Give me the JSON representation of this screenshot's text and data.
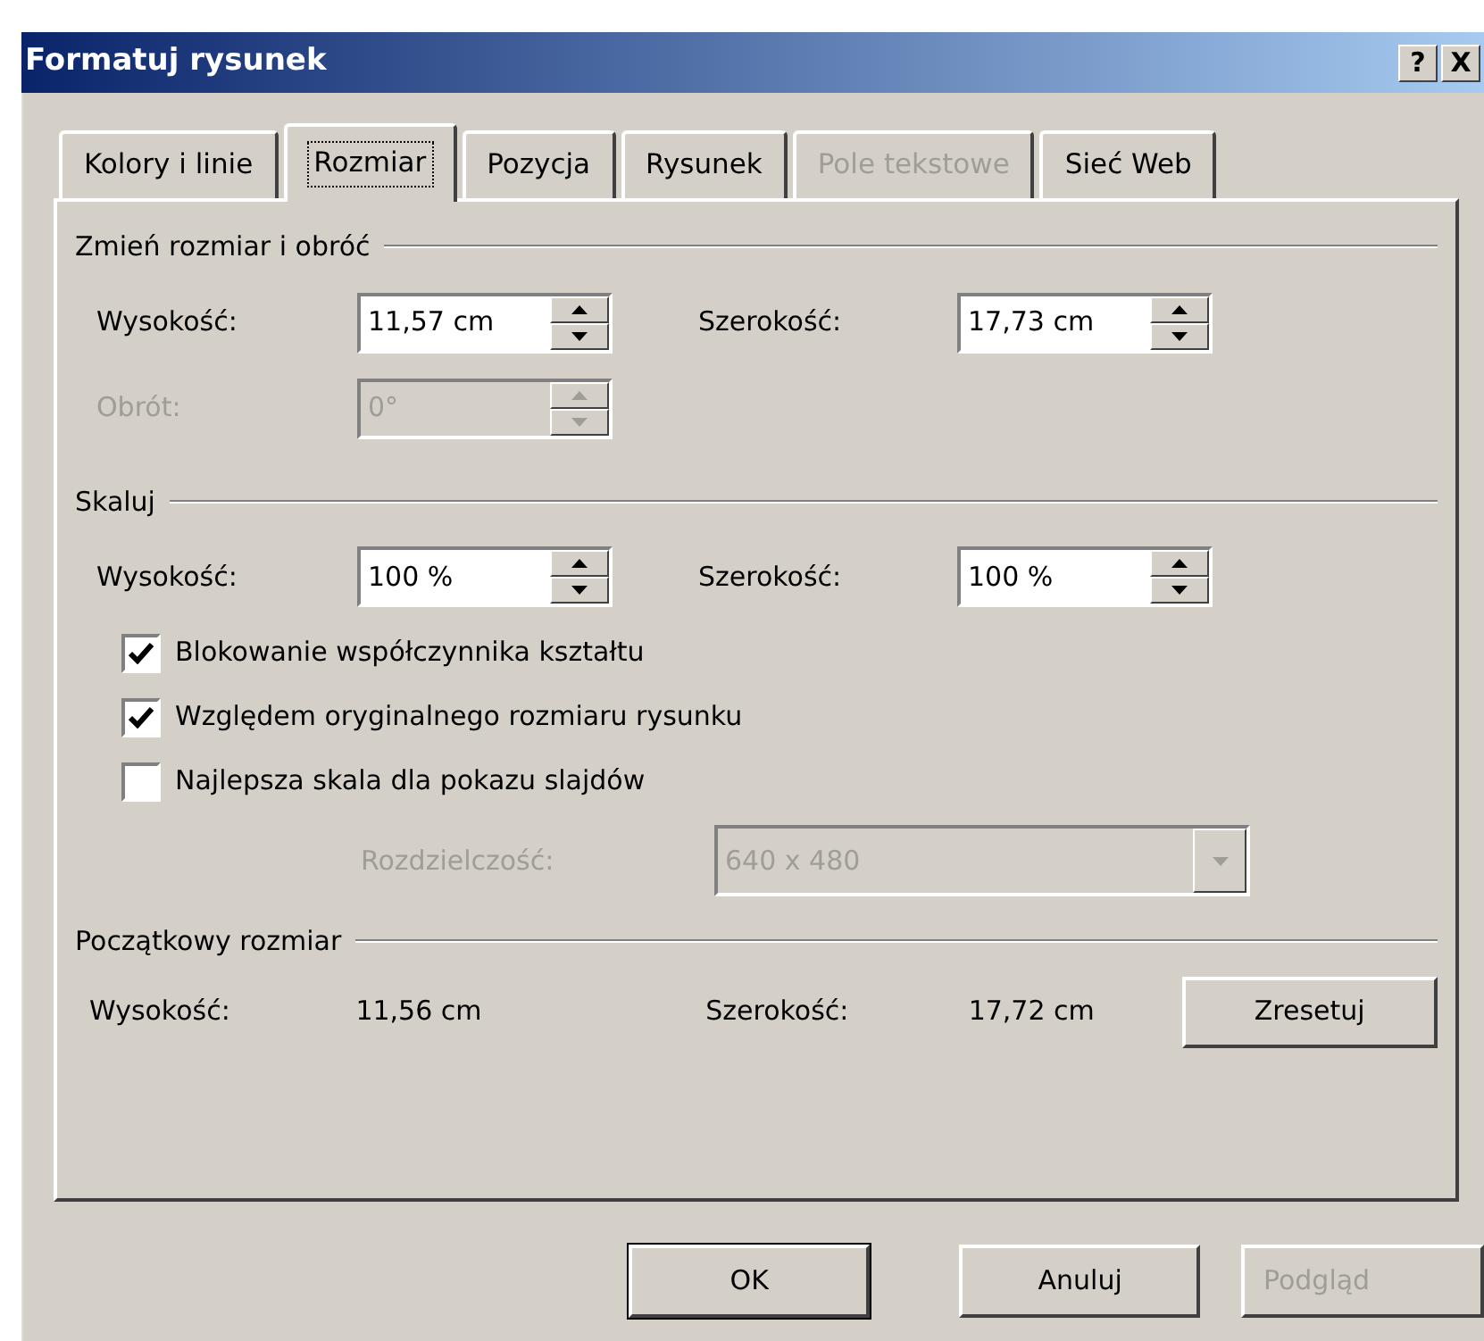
{
  "window": {
    "title": "Formatuj rysunek",
    "help_button": "?",
    "close_button": "X"
  },
  "tabs": [
    {
      "label": "Kolory i linie",
      "selected": false,
      "disabled": false
    },
    {
      "label": "Rozmiar",
      "selected": true,
      "disabled": false
    },
    {
      "label": "Pozycja",
      "selected": false,
      "disabled": false
    },
    {
      "label": "Rysunek",
      "selected": false,
      "disabled": false
    },
    {
      "label": "Pole tekstowe",
      "selected": false,
      "disabled": true
    },
    {
      "label": "Sieć Web",
      "selected": false,
      "disabled": false
    }
  ],
  "resize_section": {
    "title": "Zmień rozmiar i obróć",
    "rows": [
      [
        {
          "label": "Wysokość:",
          "value": "11,57 cm",
          "disabled": false
        },
        {
          "label": "Szerokość:",
          "value": "17,73 cm",
          "disabled": false
        }
      ],
      [
        {
          "label": "Obrót:",
          "value": "0°",
          "disabled": true
        }
      ]
    ]
  },
  "scale_section": {
    "title": "Skaluj",
    "rows": [
      [
        {
          "label": "Wysokość:",
          "value": "100 %",
          "disabled": false
        },
        {
          "label": "Szerokość:",
          "value": "100 %",
          "disabled": false
        }
      ]
    ],
    "checkboxes": [
      {
        "label": "Blokowanie współczynnika kształtu",
        "checked": true
      },
      {
        "label": "Względem oryginalnego rozmiaru rysunku",
        "checked": true
      },
      {
        "label": "Najlepsza skala dla pokazu slajdów",
        "checked": false
      }
    ],
    "resolution": {
      "label": "Rozdzielczość:",
      "value": "640 x 480",
      "disabled": true
    }
  },
  "original_section": {
    "title": "Początkowy rozmiar",
    "height_label": "Wysokość:",
    "height_value": "11,56 cm",
    "width_label": "Szerokość:",
    "width_value": "17,72 cm",
    "reset_button": "Zresetuj"
  },
  "buttons": [
    {
      "label": "OK",
      "default": true,
      "disabled": false
    },
    {
      "label": "Anuluj",
      "default": false,
      "disabled": false
    },
    {
      "label": "Podgląd",
      "default": false,
      "disabled": true
    }
  ]
}
